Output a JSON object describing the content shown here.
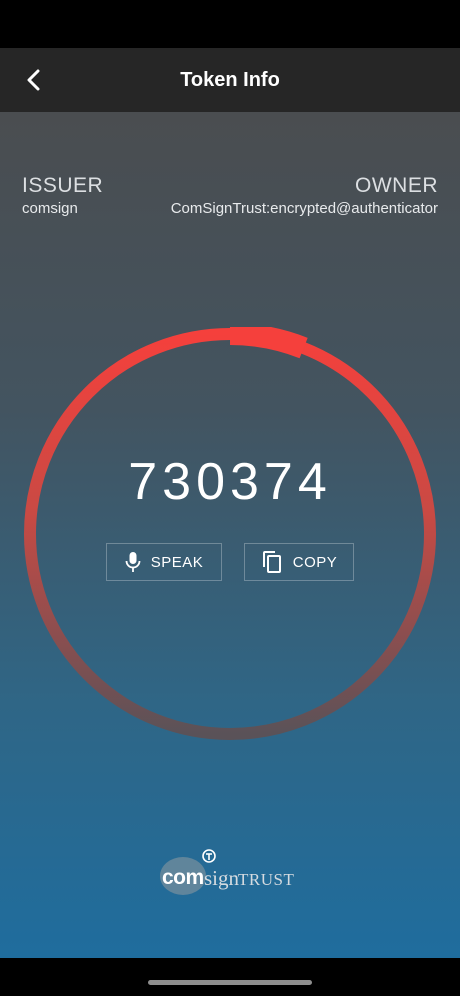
{
  "header": {
    "title": "Token Info",
    "back_icon": "chevron-left-icon"
  },
  "issuer": {
    "heading": "ISSUER",
    "value": "comsign"
  },
  "owner": {
    "heading": "OWNER",
    "value": "ComSignTrust:encrypted@authenticator"
  },
  "token": {
    "code": "730374",
    "time_remaining_fraction": 0.94
  },
  "actions": {
    "speak_label": "SPEAK",
    "speak_icon": "microphone-icon",
    "copy_label": "COPY",
    "copy_icon": "copy-icon"
  },
  "logo": {
    "part1": "com",
    "part2": "sign",
    "part3": "TRUST"
  },
  "colors": {
    "ring_start": "#f5403c",
    "ring_end": "#5a5258",
    "header_bg": "#262626"
  }
}
